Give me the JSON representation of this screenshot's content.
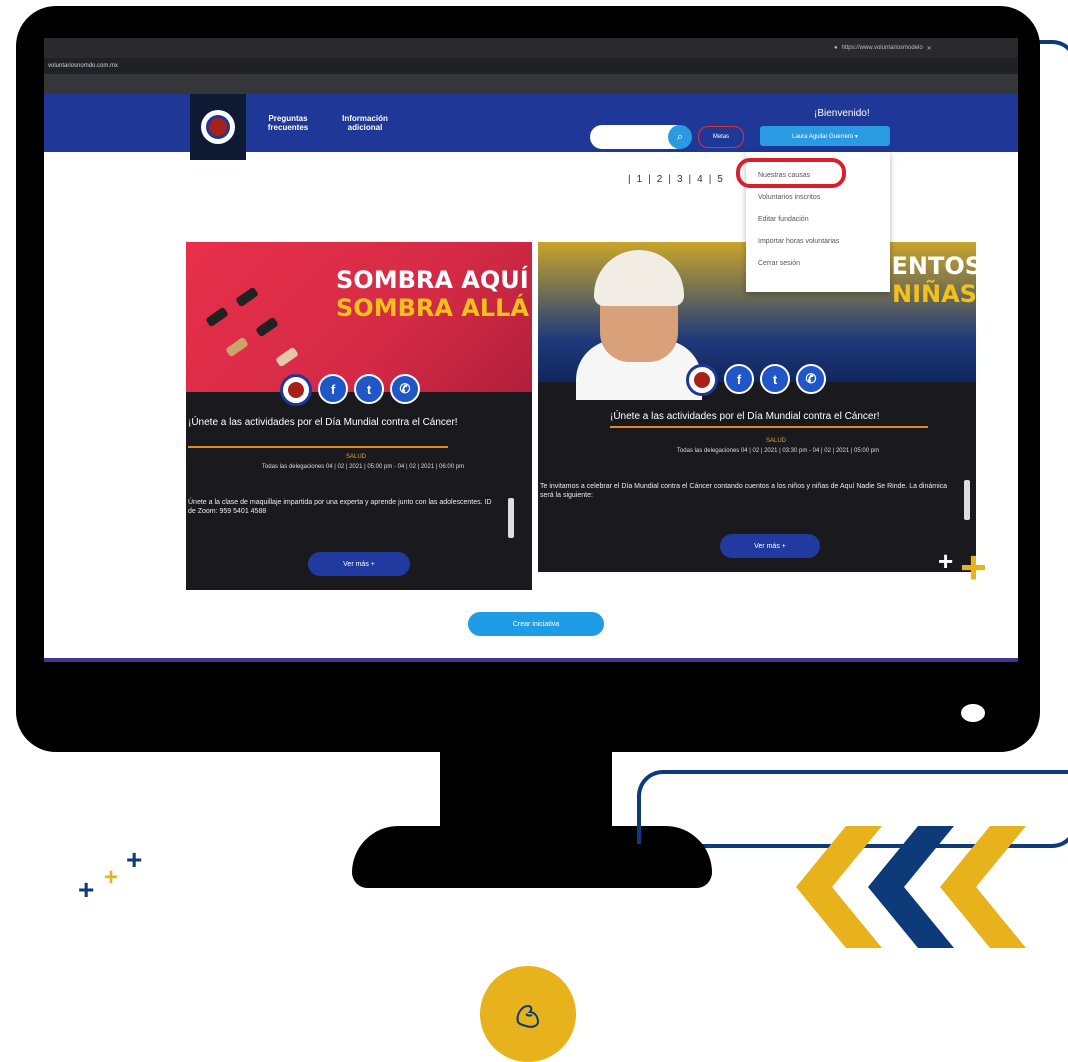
{
  "browser": {
    "address": "voluntariosnomdo.com.mx",
    "tab_title": "https://www.voluntariosmodelo"
  },
  "nav": {
    "preguntas": "Preguntas frecuentes",
    "informacion": "Información adicional",
    "welcome": "¡Bienvenido!",
    "metas": "Metas",
    "user_name": "Laura Aguilar Guerrero ▾"
  },
  "pagination": [
    "1",
    "2",
    "3",
    "4",
    "5"
  ],
  "dropdown": {
    "items": [
      "Nuestras causas",
      "Voluntarios inscritos",
      "Editar fundación",
      "Importar horas voluntarias",
      "Cerrar sesión"
    ]
  },
  "cards": [
    {
      "banner_line1": "SOMBRA AQUÍ",
      "banner_line2": "SOMBRA ALLÁ",
      "title": "¡Únete a las actividades por el Día Mundial contra el Cáncer!",
      "category": "SALUD",
      "dates": "Todas las delegaciones  04 | 02 | 2021 | 05:00 pm - 04 | 02 | 2021 | 06:00 pm",
      "description": "Únete a la clase de maquillaje impartida por una experta y aprende junto con las adolescentes. ID de Zoom: 959 5401 4588",
      "button": "Ver más +"
    },
    {
      "banner_line1": "UENTOS",
      "banner_line2": "NIÑAS",
      "title": "¡Únete a las actividades por el Día Mundial contra el Cáncer!",
      "category": "SALUD",
      "dates": "Todas las delegaciones  04 | 02 | 2021 | 03:30 pm - 04 | 02 | 2021 | 05:00 pm",
      "description": "Te invitamos a celebrar el Día Mundial contra el Cáncer contando cuentos a los niños y niñas de Aquí Nadie Se Rinde. La dinámica será la siguiente:",
      "button": "Ver más +"
    }
  ],
  "crear_button": "Crear iniciativa",
  "colors": {
    "nav_blue": "#1f3796",
    "accent_blue": "#2a9be3",
    "highlight_red": "#d91f2a",
    "deco_yellow": "#e7b21c",
    "deco_navy": "#0d3a78"
  },
  "icons": [
    "search-icon",
    "facebook-icon",
    "twitter-icon",
    "whatsapp-icon",
    "muscle-arm-icon",
    "plus-icon",
    "chevron-left-icon"
  ]
}
